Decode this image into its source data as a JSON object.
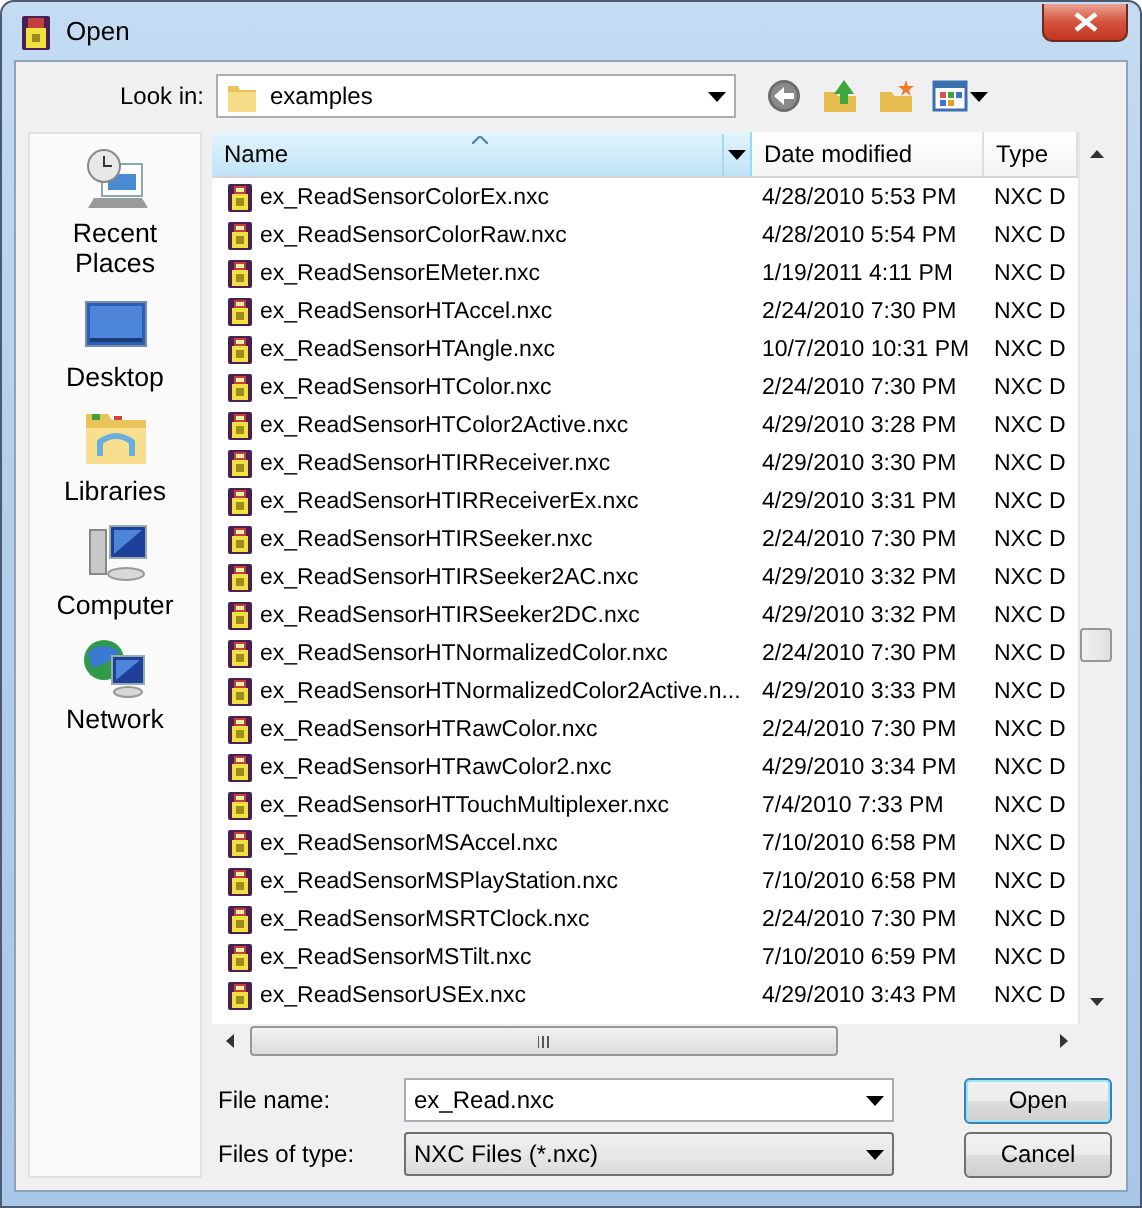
{
  "window": {
    "title": "Open"
  },
  "look_in": {
    "label": "Look in:",
    "value": "examples"
  },
  "places": [
    {
      "kind": "recent",
      "label": "Recent Places"
    },
    {
      "kind": "desktop",
      "label": "Desktop"
    },
    {
      "kind": "libraries",
      "label": "Libraries"
    },
    {
      "kind": "computer",
      "label": "Computer"
    },
    {
      "kind": "network",
      "label": "Network"
    }
  ],
  "columns": [
    {
      "label": "Name",
      "sorted": true
    },
    {
      "label": "Date modified",
      "sorted": false
    },
    {
      "label": "Type",
      "sorted": false
    }
  ],
  "files": [
    {
      "name": "ex_ReadSensorColorEx.nxc",
      "date": "4/28/2010 5:53 PM",
      "type": "NXC D"
    },
    {
      "name": "ex_ReadSensorColorRaw.nxc",
      "date": "4/28/2010 5:54 PM",
      "type": "NXC D"
    },
    {
      "name": "ex_ReadSensorEMeter.nxc",
      "date": "1/19/2011 4:11 PM",
      "type": "NXC D"
    },
    {
      "name": "ex_ReadSensorHTAccel.nxc",
      "date": "2/24/2010 7:30 PM",
      "type": "NXC D"
    },
    {
      "name": "ex_ReadSensorHTAngle.nxc",
      "date": "10/7/2010 10:31 PM",
      "type": "NXC D"
    },
    {
      "name": "ex_ReadSensorHTColor.nxc",
      "date": "2/24/2010 7:30 PM",
      "type": "NXC D"
    },
    {
      "name": "ex_ReadSensorHTColor2Active.nxc",
      "date": "4/29/2010 3:28 PM",
      "type": "NXC D"
    },
    {
      "name": "ex_ReadSensorHTIRReceiver.nxc",
      "date": "4/29/2010 3:30 PM",
      "type": "NXC D"
    },
    {
      "name": "ex_ReadSensorHTIRReceiverEx.nxc",
      "date": "4/29/2010 3:31 PM",
      "type": "NXC D"
    },
    {
      "name": "ex_ReadSensorHTIRSeeker.nxc",
      "date": "2/24/2010 7:30 PM",
      "type": "NXC D"
    },
    {
      "name": "ex_ReadSensorHTIRSeeker2AC.nxc",
      "date": "4/29/2010 3:32 PM",
      "type": "NXC D"
    },
    {
      "name": "ex_ReadSensorHTIRSeeker2DC.nxc",
      "date": "4/29/2010 3:32 PM",
      "type": "NXC D"
    },
    {
      "name": "ex_ReadSensorHTNormalizedColor.nxc",
      "date": "2/24/2010 7:30 PM",
      "type": "NXC D"
    },
    {
      "name": "ex_ReadSensorHTNormalizedColor2Active.n...",
      "date": "4/29/2010 3:33 PM",
      "type": "NXC D"
    },
    {
      "name": "ex_ReadSensorHTRawColor.nxc",
      "date": "2/24/2010 7:30 PM",
      "type": "NXC D"
    },
    {
      "name": "ex_ReadSensorHTRawColor2.nxc",
      "date": "4/29/2010 3:34 PM",
      "type": "NXC D"
    },
    {
      "name": "ex_ReadSensorHTTouchMultiplexer.nxc",
      "date": "7/4/2010 7:33 PM",
      "type": "NXC D"
    },
    {
      "name": "ex_ReadSensorMSAccel.nxc",
      "date": "7/10/2010 6:58 PM",
      "type": "NXC D"
    },
    {
      "name": "ex_ReadSensorMSPlayStation.nxc",
      "date": "7/10/2010 6:58 PM",
      "type": "NXC D"
    },
    {
      "name": "ex_ReadSensorMSRTClock.nxc",
      "date": "2/24/2010 7:30 PM",
      "type": "NXC D"
    },
    {
      "name": "ex_ReadSensorMSTilt.nxc",
      "date": "7/10/2010 6:59 PM",
      "type": "NXC D"
    },
    {
      "name": "ex_ReadSensorUSEx.nxc",
      "date": "4/29/2010 3:43 PM",
      "type": "NXC D"
    }
  ],
  "file_name": {
    "label": "File name:",
    "value": "ex_Read.nxc"
  },
  "file_type": {
    "label": "Files of type:",
    "value": "NXC Files (*.nxc)"
  },
  "buttons": [
    {
      "label": "Open",
      "default": true
    },
    {
      "label": "Cancel",
      "default": false
    }
  ]
}
